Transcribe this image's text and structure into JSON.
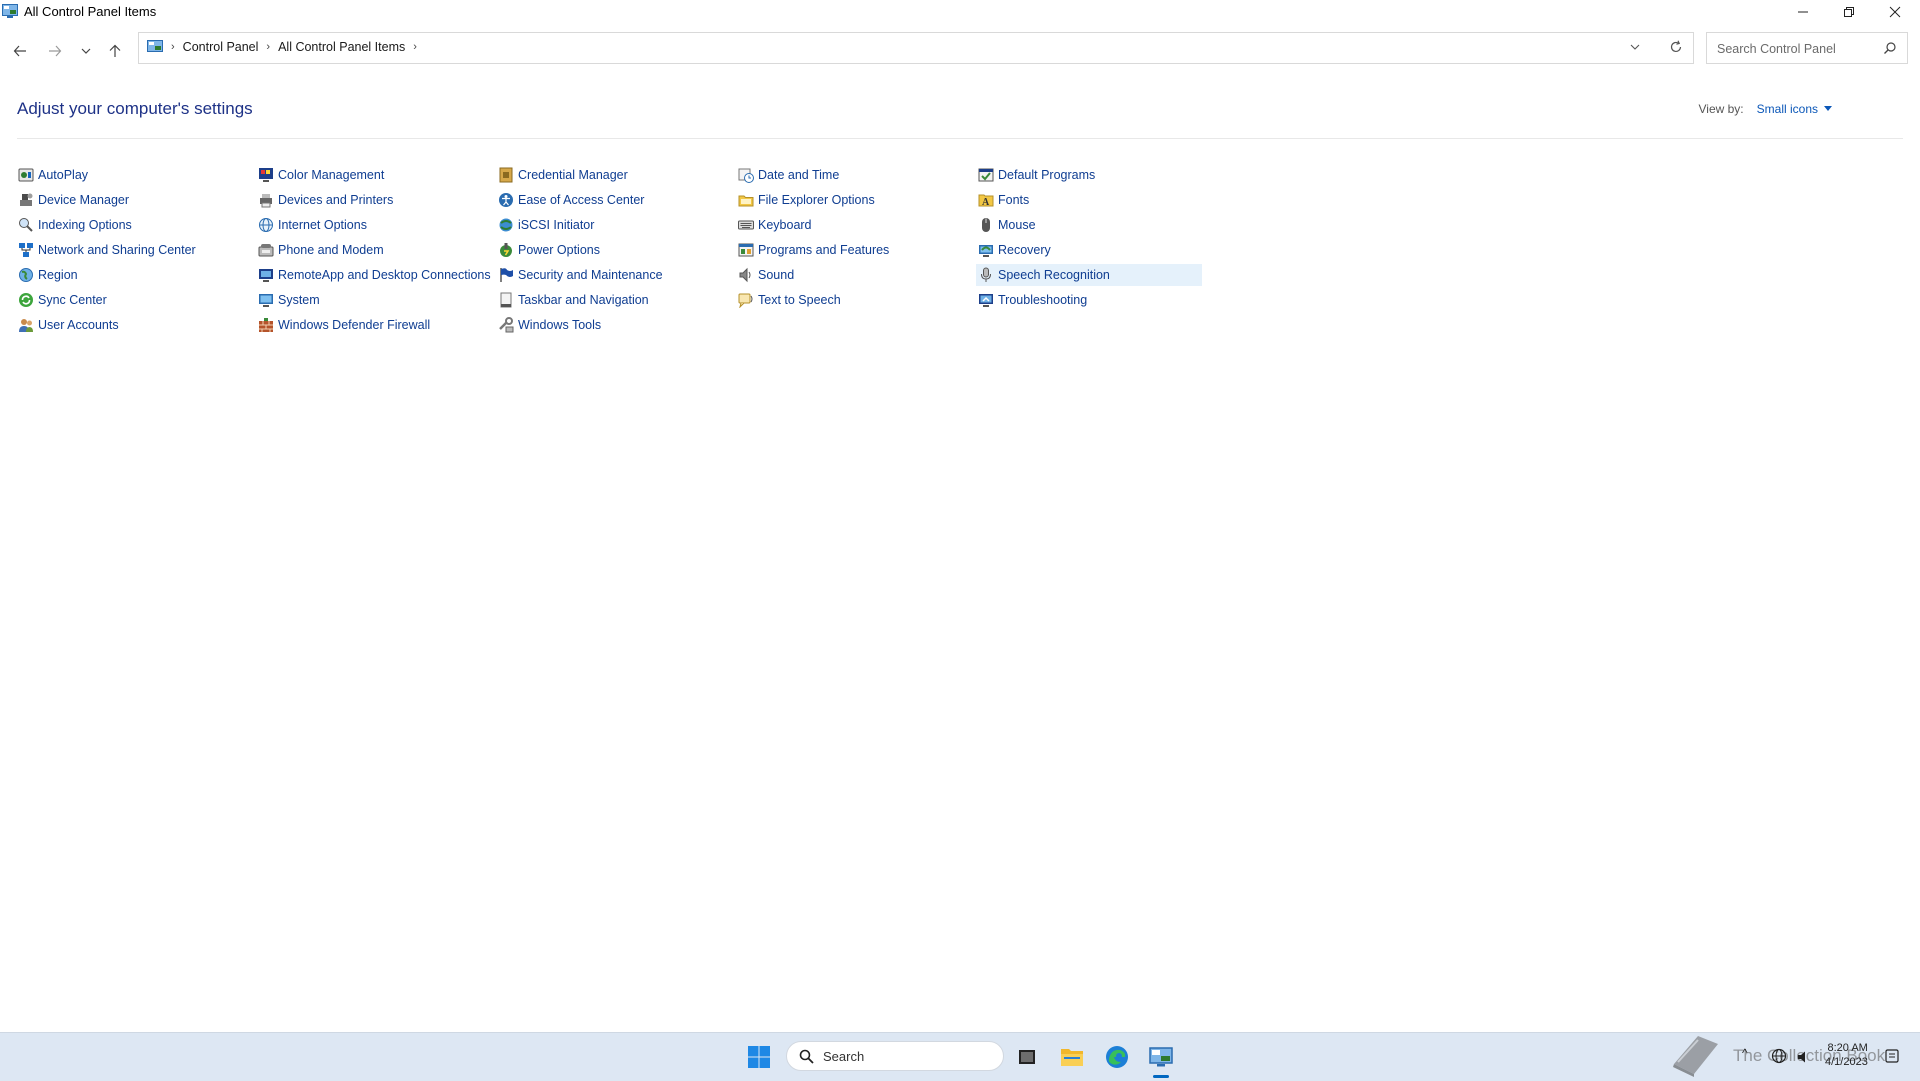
{
  "window": {
    "title": "All Control Panel Items",
    "icon": "control-panel-icon",
    "controls": [
      "minimize-icon",
      "restore-icon",
      "close-icon"
    ]
  },
  "navigation": {
    "back_icon": "back-arrow-icon",
    "forward_icon": "forward-arrow-icon",
    "recent_icon": "chevron-down-icon",
    "up_icon": "up-arrow-icon",
    "breadcrumbs": [
      "Control Panel",
      "All Control Panel Items"
    ],
    "search_placeholder": "Search Control Panel"
  },
  "header": {
    "title": "Adjust your computer's settings",
    "view_by_label": "View by:",
    "view_by_value": "Small icons"
  },
  "items": [
    {
      "label": "AutoPlay",
      "icon": "autoplay-icon"
    },
    {
      "label": "Device Manager",
      "icon": "device-manager-icon"
    },
    {
      "label": "Indexing Options",
      "icon": "indexing-options-icon"
    },
    {
      "label": "Network and Sharing Center",
      "icon": "network-icon"
    },
    {
      "label": "Region",
      "icon": "region-icon"
    },
    {
      "label": "Sync Center",
      "icon": "sync-center-icon"
    },
    {
      "label": "User Accounts",
      "icon": "user-accounts-icon"
    },
    {
      "label": "Color Management",
      "icon": "color-management-icon"
    },
    {
      "label": "Devices and Printers",
      "icon": "devices-printers-icon"
    },
    {
      "label": "Internet Options",
      "icon": "internet-options-icon"
    },
    {
      "label": "Phone and Modem",
      "icon": "phone-modem-icon"
    },
    {
      "label": "RemoteApp and Desktop Connections",
      "icon": "remoteapp-icon"
    },
    {
      "label": "System",
      "icon": "system-icon"
    },
    {
      "label": "Windows Defender Firewall",
      "icon": "firewall-icon"
    },
    {
      "label": "Credential Manager",
      "icon": "credential-manager-icon"
    },
    {
      "label": "Ease of Access Center",
      "icon": "ease-of-access-icon"
    },
    {
      "label": "iSCSI Initiator",
      "icon": "iscsi-icon"
    },
    {
      "label": "Power Options",
      "icon": "power-options-icon"
    },
    {
      "label": "Security and Maintenance",
      "icon": "security-flag-icon"
    },
    {
      "label": "Taskbar and Navigation",
      "icon": "taskbar-icon"
    },
    {
      "label": "Windows Tools",
      "icon": "windows-tools-icon"
    },
    {
      "label": "Date and Time",
      "icon": "date-time-icon"
    },
    {
      "label": "File Explorer Options",
      "icon": "folder-options-icon"
    },
    {
      "label": "Keyboard",
      "icon": "keyboard-icon"
    },
    {
      "label": "Programs and Features",
      "icon": "programs-features-icon"
    },
    {
      "label": "Sound",
      "icon": "sound-icon"
    },
    {
      "label": "Text to Speech",
      "icon": "text-to-speech-icon"
    },
    {
      "label": "Default Programs",
      "icon": "default-programs-icon"
    },
    {
      "label": "Fonts",
      "icon": "fonts-icon"
    },
    {
      "label": "Mouse",
      "icon": "mouse-icon"
    },
    {
      "label": "Recovery",
      "icon": "recovery-icon"
    },
    {
      "label": "Speech Recognition",
      "icon": "microphone-icon",
      "highlighted": true
    },
    {
      "label": "Troubleshooting",
      "icon": "troubleshooting-icon"
    }
  ],
  "taskbar": {
    "search_label": "Search",
    "apps": [
      "start-icon",
      "task-view-icon",
      "file-explorer-icon",
      "edge-icon",
      "control-panel-icon"
    ],
    "watermark": "The Collection Book",
    "time": "8:20 AM",
    "date": "4/1/2023"
  },
  "colors": {
    "link": "#0f3d91",
    "heading": "#1e3287",
    "highlight": "#e5f1fb",
    "taskbar": "#dde7f3"
  }
}
